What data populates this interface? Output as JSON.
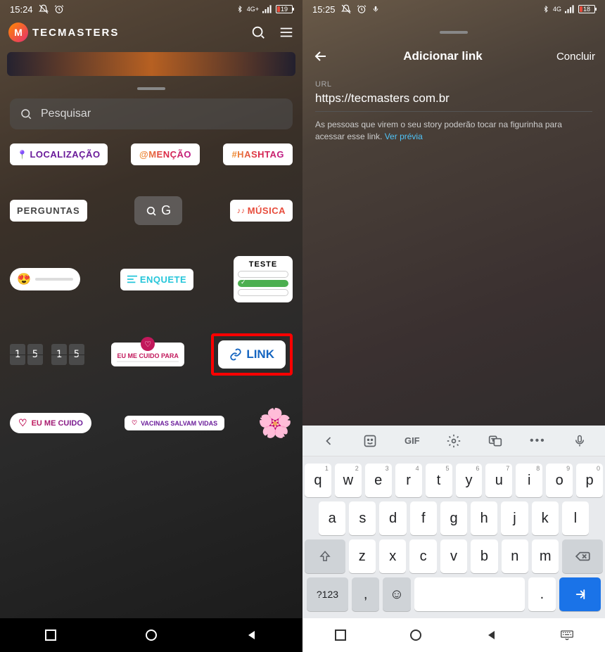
{
  "left": {
    "status": {
      "time": "15:24",
      "network": "4G+",
      "battery_pct": 19
    },
    "brand": {
      "prefix": "TEC",
      "suffix": "MASTERS"
    },
    "search": {
      "placeholder": "Pesquisar"
    },
    "stickers": {
      "localizacao": "LOCALIZAÇÃO",
      "mencao": "@MENÇÃO",
      "hashtag": "#HASHTAG",
      "perguntas": "PERGUNTAS",
      "gif_letter": "G",
      "musica": "MÚSICA",
      "enquete": "ENQUETE",
      "teste": "TESTE",
      "clock": {
        "h1": "1",
        "h2": "5",
        "m1": "1",
        "m2": "5"
      },
      "cuido_para": "EU ME CUIDO PARA",
      "link": "LINK",
      "eu_me_cuido": "EU ME CUIDO",
      "vacinas": "VACINAS SALVAM VIDAS"
    }
  },
  "right": {
    "status": {
      "time": "15:25",
      "network": "4G",
      "battery_pct": 18
    },
    "header": {
      "title": "Adicionar link",
      "done": "Concluir"
    },
    "url": {
      "label": "URL",
      "value": "https://tecmasters com.br",
      "hint": "As pessoas que virem o seu story poderão tocar na figurinha para acessar esse link.",
      "preview": "Ver prévia"
    },
    "keyboard": {
      "toolbar": {
        "gif": "GIF"
      },
      "row1": [
        "q",
        "w",
        "e",
        "r",
        "t",
        "y",
        "u",
        "i",
        "o",
        "p"
      ],
      "row1_sup": [
        "1",
        "2",
        "3",
        "4",
        "5",
        "6",
        "7",
        "8",
        "9",
        "0"
      ],
      "row2": [
        "a",
        "s",
        "d",
        "f",
        "g",
        "h",
        "j",
        "k",
        "l"
      ],
      "row3": [
        "z",
        "x",
        "c",
        "v",
        "b",
        "n",
        "m"
      ],
      "sym": "?123",
      "period": "."
    }
  }
}
